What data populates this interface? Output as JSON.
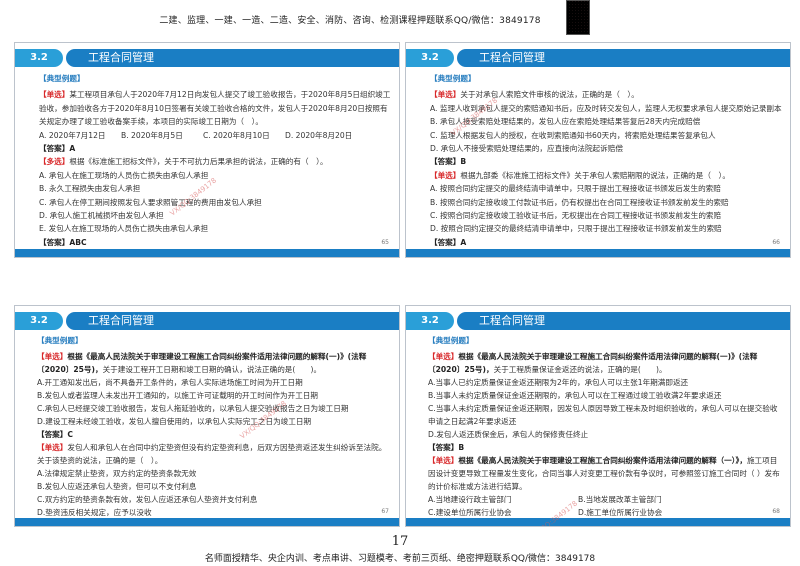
{
  "top_banner": "二建、监理、一建、一造、二造、安全、消防、咨询、检测课程押题联系QQ/微信：3849178",
  "bottom_banner": "名师面授精华、央企内训、考点串讲、习题模考、考前三页纸、绝密押题联系QQ/微信：3849178",
  "page_number": "17",
  "watermark": "VX/QQ:3849178",
  "slides": [
    {
      "section": "3.2",
      "title": "工程合同管理",
      "heading": "【典型例题】",
      "page": "65",
      "lines": [
        {
          "tag": "【单选】",
          "text": "某工程项目承包人于2020年7月12日向发包人提交了竣工验收报告，于2020年8月5日组织竣工验收，参加验收各方于2020年8月10日签署有关竣工验收合格的文件，发包人于2020年8月20日按照有关规定办理了竣工验收备案手续，本项目的实际竣工日期为（　）。"
        },
        {
          "opts": [
            "A. 2020年7月12日",
            "B. 2020年8月5日",
            "C. 2020年8月10日",
            "D. 2020年8月20日"
          ]
        },
        {
          "ans": "【答案】A"
        },
        {
          "tag": "【多选】",
          "text": "根据《标准施工招标文件》，关于不可抗力后果承担的说法，正确的有（　）。"
        },
        {
          "text": "A. 承包人在施工现场的人员伤亡损失由承包人承担"
        },
        {
          "text": "B. 永久工程损失由发包人承担"
        },
        {
          "text": "C. 承包人在停工期间按照发包人要求照管工程的费用由发包人承担"
        },
        {
          "text": "D. 承包人施工机械损坏由发包人承担"
        },
        {
          "text": "E. 发包人在施工现场的人员伤亡损失由承包人承担"
        },
        {
          "ans": "【答案】ABC"
        }
      ]
    },
    {
      "section": "3.2",
      "title": "工程合同管理",
      "heading": "【典型例题】",
      "page": "66",
      "lines": [
        {
          "tag": "【单选】",
          "text": "关于对承包人索赔文件审核的说法，正确的是（　）。"
        },
        {
          "text": "A. 监理人收到承包人提交的索赔通知书后，应及时转交发包人，监理人无权要求承包人提交原始记录副本"
        },
        {
          "text": "B. 承包人接受索赔处理结果的，发包人应在索赔处理结果答复后28天内完成赔偿"
        },
        {
          "text": "C. 监理人根据发包人的授权，在收到索赔通知书60天内，将索赔处理结果答复承包人"
        },
        {
          "text": "D. 承包人不接受索赔处理结果的，应直接向法院起诉赔偿"
        },
        {
          "ans": "【答案】B"
        },
        {
          "tag": "【单选】",
          "text": "根据九部委《标准施工招标文件》关于承包人索赔期限的说法，正确的是（　）。"
        },
        {
          "text": "A. 按照合同约定提交的最终结清申请单中，只限于提出工程接收证书颁发后发生的索赔"
        },
        {
          "text": "B. 按照合同约定接收竣工付款证书后，仍有权提出在合同工程接收证书颁发前发生的索赔"
        },
        {
          "text": "C. 按照合同约定接收竣工验收证书后，无权提出在合同工程接收证书颁发前发生的索赔"
        },
        {
          "text": "D. 按照合同约定提交的最终结清申请单中，只限于提出工程接收证书颁发前发生的索赔"
        },
        {
          "ans": "【答案】A"
        }
      ]
    },
    {
      "section": "3.2",
      "title": "工程合同管理",
      "heading": "【典型例题】",
      "page": "67",
      "lines": [
        {
          "tag": "【单选】",
          "bold": "根据《最高人民法院关于审理建设工程施工合同纠纷案件适用法律问题的解释(一)》(法释〔2020〕25号)，",
          "text": "关于建设工程开工日期和竣工日期的确认，说法正确的是(　　)。"
        },
        {
          "text": "A.开工通知发出后，尚不具备开工条件的，承包人实际进场施工时间为开工日期"
        },
        {
          "text": "B.发包人或者监理人未发出开工通知的，以施工许可证载明的开工时间作为开工日期"
        },
        {
          "text": "C.承包人已经提交竣工验收报告，发包人拖延验收的，以承包人提交验收报告之日为竣工日期"
        },
        {
          "text": "D.建设工程未经竣工验收，发包人擅自使用的，以承包人实际完工之日为竣工日期"
        },
        {
          "ans": "【答案】C"
        },
        {
          "tag": "【单选】",
          "text": "发包人和承包人在合同中约定垫资但没有约定垫资利息，后双方因垫资返还发生纠纷诉至法院。关于该垫资的说法，正确的是（　）。"
        },
        {
          "text": "A.法律规定禁止垫资，双方约定的垫资条款无效"
        },
        {
          "text": "B.发包人应返还承包人垫资，但可以不支付利息"
        },
        {
          "text": "C.双方约定的垫资条款有效，发包人应返还承包人垫资并支付利息"
        },
        {
          "text": "D.垫资违反相关规定，应予以没收"
        },
        {
          "ans": "【答案】B"
        }
      ]
    },
    {
      "section": "3.2",
      "title": "工程合同管理",
      "heading": "【典型例题】",
      "page": "68",
      "lines": [
        {
          "tag": "【单选】",
          "bold": "根据《最高人民法院关于审理建设工程施工合同纠纷案件适用法律问题的解释(一)》(法释〔2020〕25号)，",
          "text": "关于工程质量保证金返还的说法，正确的是(　　)。"
        },
        {
          "text": "A.当事人已约定质量保证金返还期限为2年的，承包人可以主张1年期满即返还"
        },
        {
          "text": "B.当事人未约定质量保证金返还期限的，承包人可以在工程通过竣工验收满2年要求返还"
        },
        {
          "text": "C.当事人未约定质量保证金返还期限，因发包人原因导致工程未及时组织验收的，承包人可以在提交验收申请之日起满2年要求返还"
        },
        {
          "text": "D.发包人返还质保金后，承包人的保修责任终止"
        },
        {
          "ans": "【答案】B"
        },
        {
          "tag": "【单选】",
          "bold": "根据《最高人民法院关于审理建设工程施工合同纠纷案件适用法律问题的解释（一）》，",
          "text": "施工项目因设计变更导致工程量发生变化，合同当事人对变更工程价款有争议时，可参照签订施工合同时（ ）发布的计价标准或方法进行结算。"
        },
        {
          "opts": [
            "A.当地建设行政主管部门",
            "B.当地发展改革主管部门"
          ]
        },
        {
          "opts": [
            "C.建设单位所属行业协会",
            "D.施工单位所属行业协会"
          ]
        },
        {
          "ans": "【答案】A"
        }
      ]
    }
  ]
}
